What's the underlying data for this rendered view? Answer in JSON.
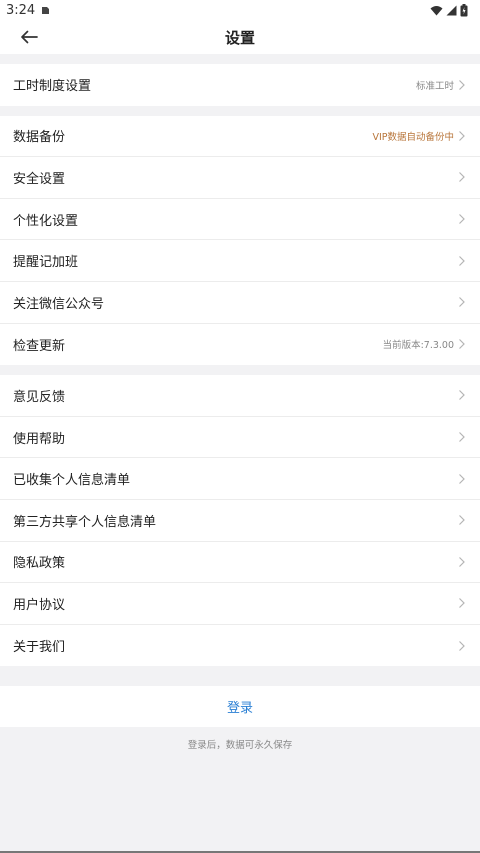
{
  "status_bar": {
    "time": "3:24"
  },
  "header": {
    "title": "设置"
  },
  "groups": [
    {
      "items": [
        {
          "label": "工时制度设置",
          "value": "标准工时"
        }
      ]
    },
    {
      "items": [
        {
          "label": "数据备份",
          "value": "VIP数据自动备份中",
          "value_color": "#b8753a"
        },
        {
          "label": "安全设置"
        },
        {
          "label": "个性化设置"
        },
        {
          "label": "提醒记加班"
        },
        {
          "label": "关注微信公众号"
        },
        {
          "label": "检查更新",
          "value": "当前版本:7.3.00"
        }
      ]
    },
    {
      "items": [
        {
          "label": "意见反馈"
        },
        {
          "label": "使用帮助"
        },
        {
          "label": "已收集个人信息清单"
        },
        {
          "label": "第三方共享个人信息清单"
        },
        {
          "label": "隐私政策"
        },
        {
          "label": "用户协议"
        },
        {
          "label": "关于我们"
        }
      ]
    }
  ],
  "login": {
    "label": "登录",
    "hint": "登录后，数据可永久保存",
    "color": "#2a7fd4"
  }
}
